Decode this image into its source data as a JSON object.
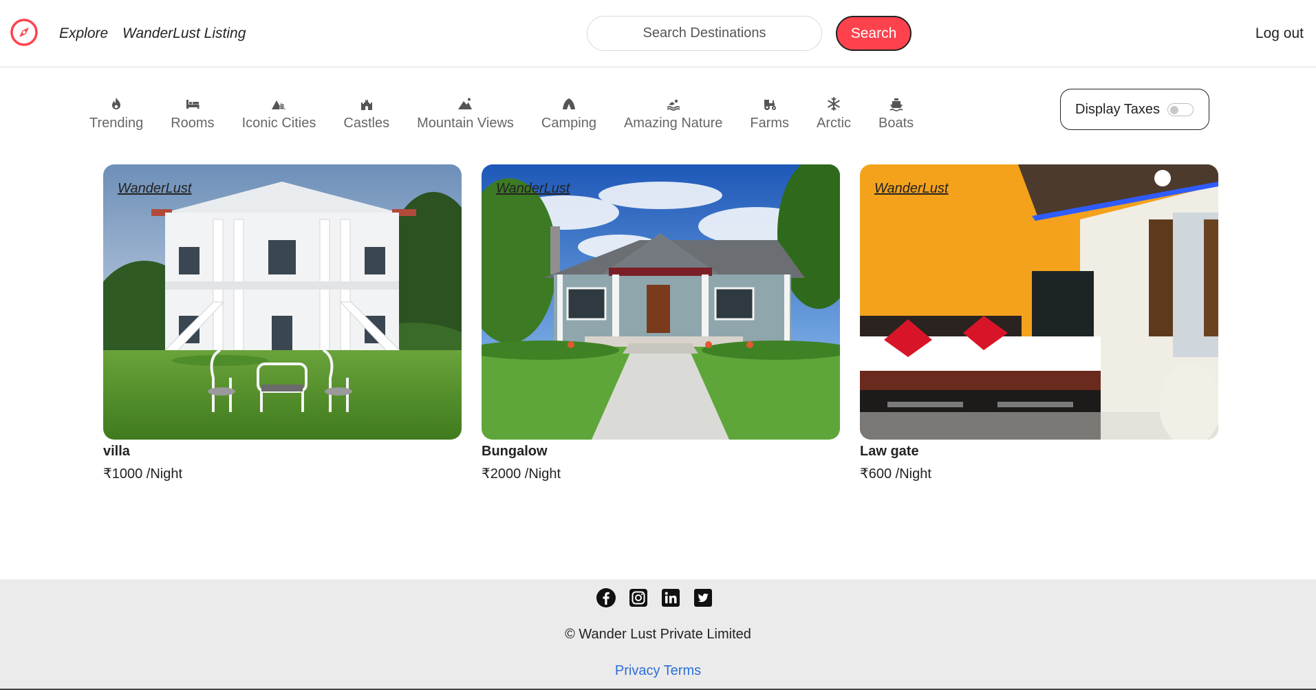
{
  "navbar": {
    "explore": "Explore",
    "listing": "WanderLust Listing",
    "search_placeholder": "Search Destinations",
    "search_button": "Search",
    "logout": "Log out",
    "logo_icon": "compass-icon",
    "accent_color": "#fe424d"
  },
  "filters": [
    {
      "label": "Trending",
      "icon": "fire-icon"
    },
    {
      "label": "Rooms",
      "icon": "bed-icon"
    },
    {
      "label": "Iconic Cities",
      "icon": "city-icon"
    },
    {
      "label": "Castles",
      "icon": "castle-icon"
    },
    {
      "label": "Mountain Views",
      "icon": "mountain-icon"
    },
    {
      "label": "Camping",
      "icon": "tent-icon"
    },
    {
      "label": "Amazing Nature",
      "icon": "swimmer-icon"
    },
    {
      "label": "Farms",
      "icon": "tractor-icon"
    },
    {
      "label": "Arctic",
      "icon": "snowflake-icon"
    },
    {
      "label": "Boats",
      "icon": "ship-icon"
    }
  ],
  "tax_toggle": {
    "label": "Display Taxes",
    "enabled": false
  },
  "listings": [
    {
      "brand": "WanderLust",
      "title": "villa",
      "price": "₹1000 /Night"
    },
    {
      "brand": "WanderLust",
      "title": "Bungalow",
      "price": "₹2000 /Night"
    },
    {
      "brand": "WanderLust",
      "title": "Law gate",
      "price": "₹600 /Night"
    }
  ],
  "footer": {
    "socials": [
      "facebook-icon",
      "instagram-icon",
      "linkedin-icon",
      "twitter-icon"
    ],
    "copyright": "© Wander Lust Private Limited",
    "privacy": "Privacy",
    "terms": "Terms",
    "link_color": "#2d6fd6"
  }
}
